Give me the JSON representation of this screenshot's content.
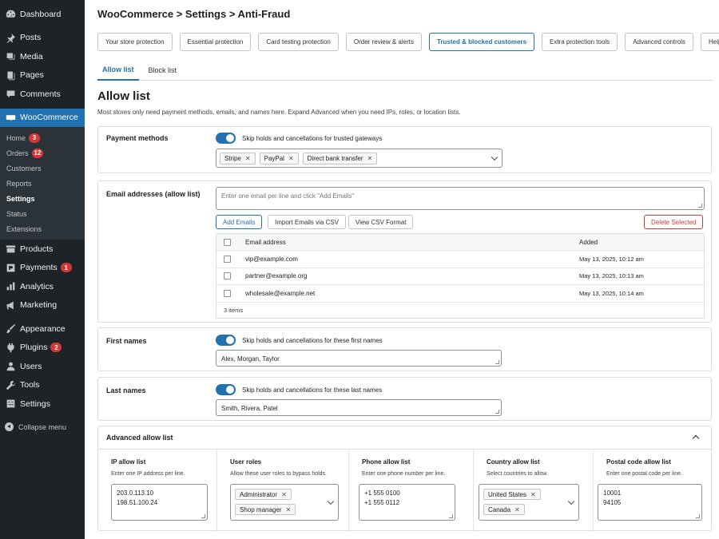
{
  "sidebar": {
    "items": [
      {
        "label": "Dashboard",
        "icon": "dashboard-icon"
      },
      {
        "label": "Posts",
        "icon": "pin-icon"
      },
      {
        "label": "Media",
        "icon": "media-icon"
      },
      {
        "label": "Pages",
        "icon": "pages-icon"
      },
      {
        "label": "Comments",
        "icon": "comment-icon"
      },
      {
        "label": "WooCommerce",
        "icon": "woo-icon"
      },
      {
        "label": "Products",
        "icon": "products-icon"
      },
      {
        "label": "Payments",
        "icon": "payments-icon",
        "badge": "1"
      },
      {
        "label": "Analytics",
        "icon": "analytics-icon"
      },
      {
        "label": "Marketing",
        "icon": "marketing-icon"
      },
      {
        "label": "Appearance",
        "icon": "brush-icon"
      },
      {
        "label": "Plugins",
        "icon": "plugin-icon",
        "badge": "2"
      },
      {
        "label": "Users",
        "icon": "user-icon"
      },
      {
        "label": "Tools",
        "icon": "wrench-icon"
      },
      {
        "label": "Settings",
        "icon": "settings-icon"
      }
    ],
    "woo_sub": [
      {
        "label": "Home",
        "badge": "3"
      },
      {
        "label": "Orders",
        "badge": "12"
      },
      {
        "label": "Customers"
      },
      {
        "label": "Reports"
      },
      {
        "label": "Settings"
      },
      {
        "label": "Status"
      },
      {
        "label": "Extensions"
      }
    ],
    "collapse_label": "Collapse menu"
  },
  "header": {
    "title": "WooCommerce > Settings > Anti-Fraud"
  },
  "tabs": [
    {
      "label": "Your store protection"
    },
    {
      "label": "Essential protection"
    },
    {
      "label": "Card testing protection"
    },
    {
      "label": "Order review & alerts"
    },
    {
      "label": "Trusted & blocked customers"
    },
    {
      "label": "Extra protection tools"
    },
    {
      "label": "Advanced controls"
    },
    {
      "label": "Help"
    }
  ],
  "subtabs": [
    {
      "label": "Allow list"
    },
    {
      "label": "Block list"
    }
  ],
  "page": {
    "title": "Allow list",
    "description": "Most stores only need payment methods, emails, and names here. Expand Advanced when you need IPs, roles, or location lists."
  },
  "payment": {
    "label": "Payment methods",
    "toggle_text": "Skip holds and cancellations for trusted gateways",
    "chips": [
      "Stripe",
      "PayPal",
      "Direct bank transfer"
    ]
  },
  "emails": {
    "label": "Email addresses (allow list)",
    "placeholder": "Enter one email per line and click \"Add Emails\"",
    "add_label": "Add Emails",
    "import_label": "Import Emails via CSV",
    "view_label": "View CSV Format",
    "delete_label": "Delete Selected",
    "col_email": "Email address",
    "col_added": "Added",
    "rows": [
      {
        "email": "vip@example.com",
        "added": "May 13, 2025, 10:12 am"
      },
      {
        "email": "partner@example.org",
        "added": "May 13, 2025, 10:13 am"
      },
      {
        "email": "wholesale@example.net",
        "added": "May 13, 2025, 10:14 am"
      }
    ],
    "count": "3 items"
  },
  "first_names": {
    "label": "First names",
    "toggle_text": "Skip holds and cancellations for these first names",
    "value": "Alex, Morgan, Taylor"
  },
  "last_names": {
    "label": "Last names",
    "toggle_text": "Skip holds and cancellations for these last names",
    "value": "Smith, Rivera, Patel"
  },
  "advanced": {
    "title": "Advanced allow list",
    "ip": {
      "label": "IP allow list",
      "hint": "Enter one IP address per line.",
      "values": [
        "203.0.113.10",
        "198.51.100.24"
      ]
    },
    "roles": {
      "label": "User roles",
      "hint": "Allow these user roles to bypass holds.",
      "chips": [
        "Administrator",
        "Shop manager"
      ]
    },
    "phone": {
      "label": "Phone allow list",
      "hint": "Enter one phone number per line.",
      "values": [
        "+1 555 0100",
        "+1 555 0112"
      ]
    },
    "country": {
      "label": "Country allow list",
      "hint": "Select countries to allow.",
      "chips": [
        "United States",
        "Canada"
      ]
    },
    "postal": {
      "label": "Postal code allow list",
      "hint": "Enter one postal code per line.",
      "values": [
        "10001",
        "94105"
      ]
    }
  }
}
